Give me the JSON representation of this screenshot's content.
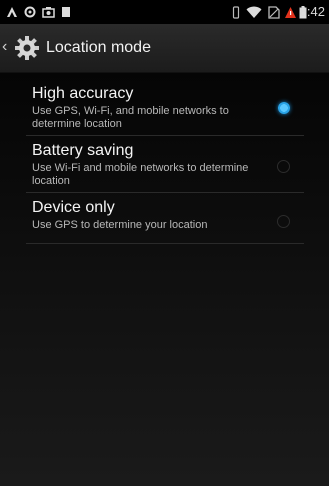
{
  "status_bar": {
    "left_icons": [
      "notification-icon",
      "sync-icon",
      "image-icon",
      "sd-card-icon"
    ],
    "right_icons": [
      "vibrate-icon",
      "wifi-icon",
      "no-sim-icon",
      "alert-icon",
      "battery-icon"
    ],
    "time": "8:42"
  },
  "action_bar": {
    "title": "Location mode",
    "icon": "settings-gear-icon"
  },
  "options": [
    {
      "title": "High accuracy",
      "description": "Use GPS, Wi-Fi, and mobile networks to determine location",
      "selected": true
    },
    {
      "title": "Battery saving",
      "description": "Use Wi-Fi and mobile networks to determine location",
      "selected": false
    },
    {
      "title": "Device only",
      "description": "Use GPS to determine your location",
      "selected": false
    }
  ],
  "colors": {
    "accent": "#2aa3e6",
    "background": "#000000",
    "action_bar": "#222222"
  }
}
